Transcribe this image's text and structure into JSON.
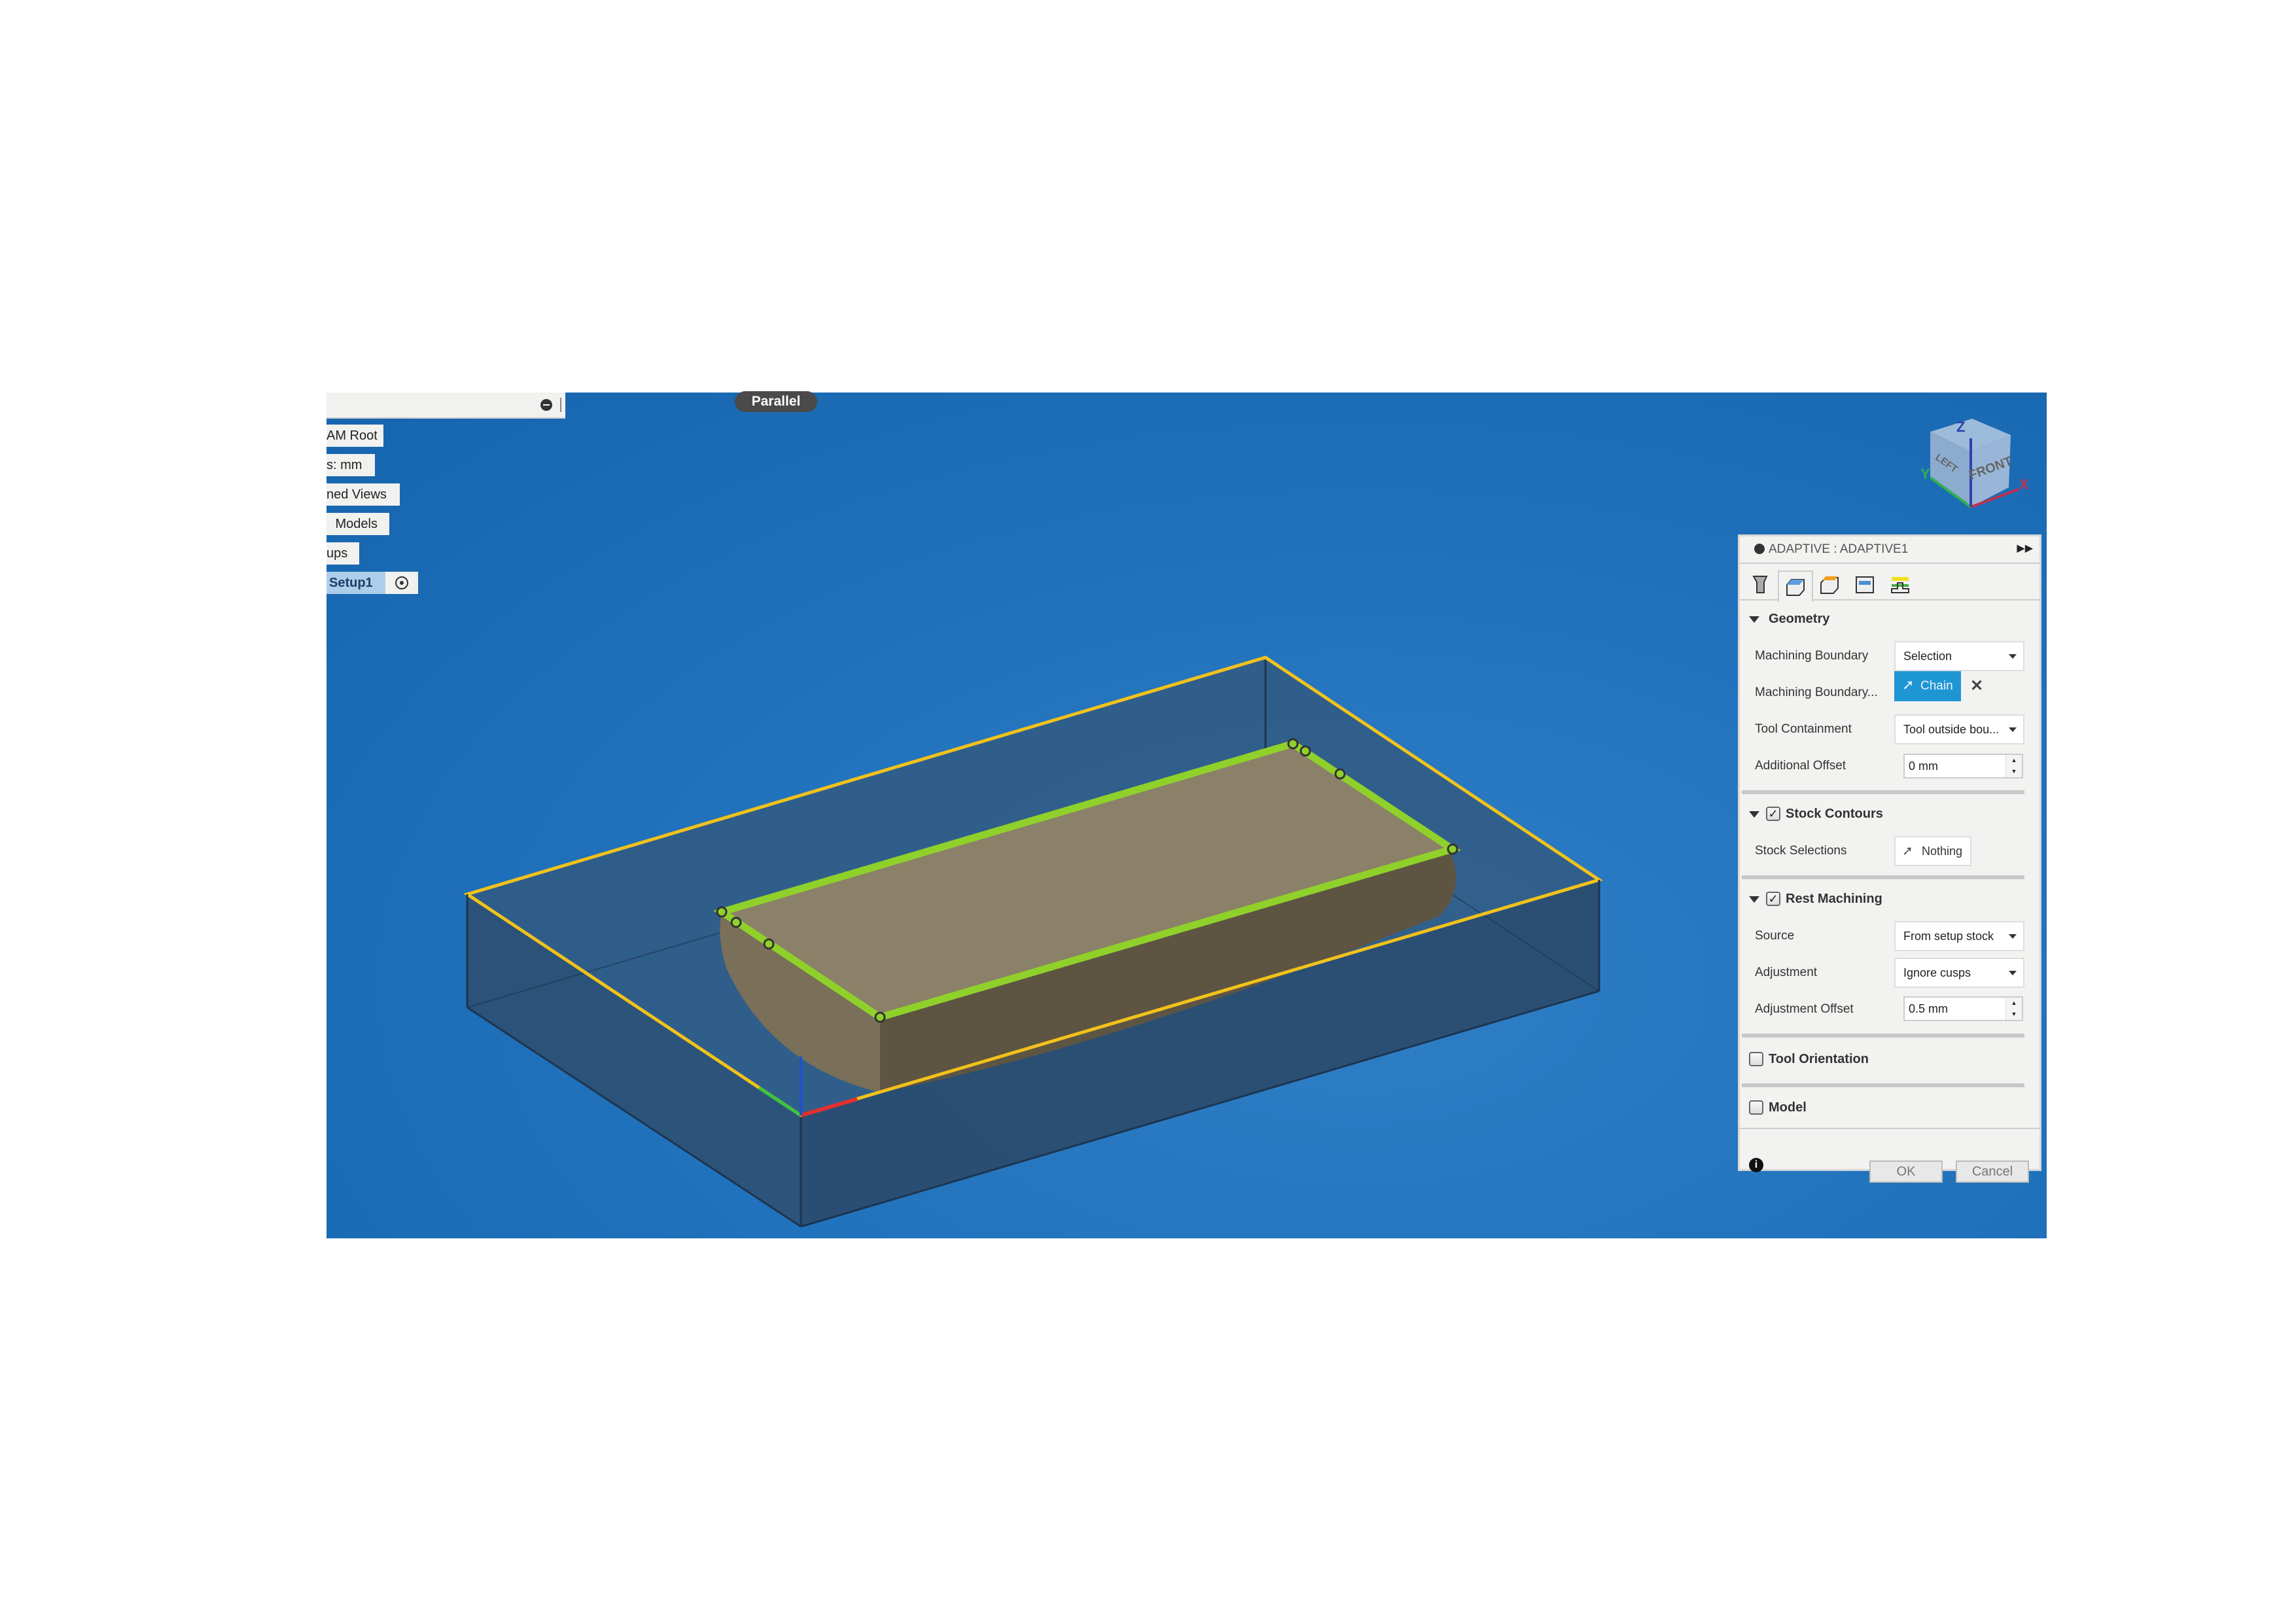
{
  "viewport": {
    "projection_label": "Parallel",
    "background_color": "#1f6fb8",
    "stock_outline_color": "#f2c21b",
    "boundary_chain_color": "#8fd12a",
    "viewcube": {
      "top": "",
      "left_face": "LEFT",
      "front_face": "FRONT",
      "axes": {
        "x": "X",
        "y": "Y",
        "z": "Z"
      }
    }
  },
  "browser_tree": {
    "items": [
      {
        "label": "AM Root"
      },
      {
        "label": "s: mm"
      },
      {
        "label": "ned Views"
      },
      {
        "label": "Models"
      },
      {
        "label": "ups"
      },
      {
        "label": "Setup1",
        "selected": true
      }
    ]
  },
  "panel": {
    "title": "ADAPTIVE : ADAPTIVE1",
    "tabs": [
      "tool-icon",
      "geometry-icon",
      "heights-icon",
      "passes-icon",
      "linking-icon"
    ],
    "active_tab": 1,
    "geometry": {
      "header": "Geometry",
      "machining_boundary_label": "Machining Boundary",
      "machining_boundary_value": "Selection",
      "boundary_selection_label": "Machining Boundary...",
      "boundary_selection_value": "Chain",
      "tool_containment_label": "Tool Containment",
      "tool_containment_value": "Tool outside bou...",
      "additional_offset_label": "Additional Offset",
      "additional_offset_value": "0 mm"
    },
    "stock_contours": {
      "header": "Stock Contours",
      "checked": true,
      "stock_selections_label": "Stock Selections",
      "stock_selections_value": "Nothing"
    },
    "rest_machining": {
      "header": "Rest Machining",
      "checked": true,
      "source_label": "Source",
      "source_value": "From setup stock",
      "adjustment_label": "Adjustment",
      "adjustment_value": "Ignore cusps",
      "adjustment_offset_label": "Adjustment Offset",
      "adjustment_offset_value": "0.5 mm"
    },
    "tool_orientation": {
      "header": "Tool Orientation",
      "checked": false
    },
    "model": {
      "header": "Model",
      "checked": false
    },
    "ok_label": "OK",
    "cancel_label": "Cancel",
    "chain_color": "#1f96d4"
  }
}
